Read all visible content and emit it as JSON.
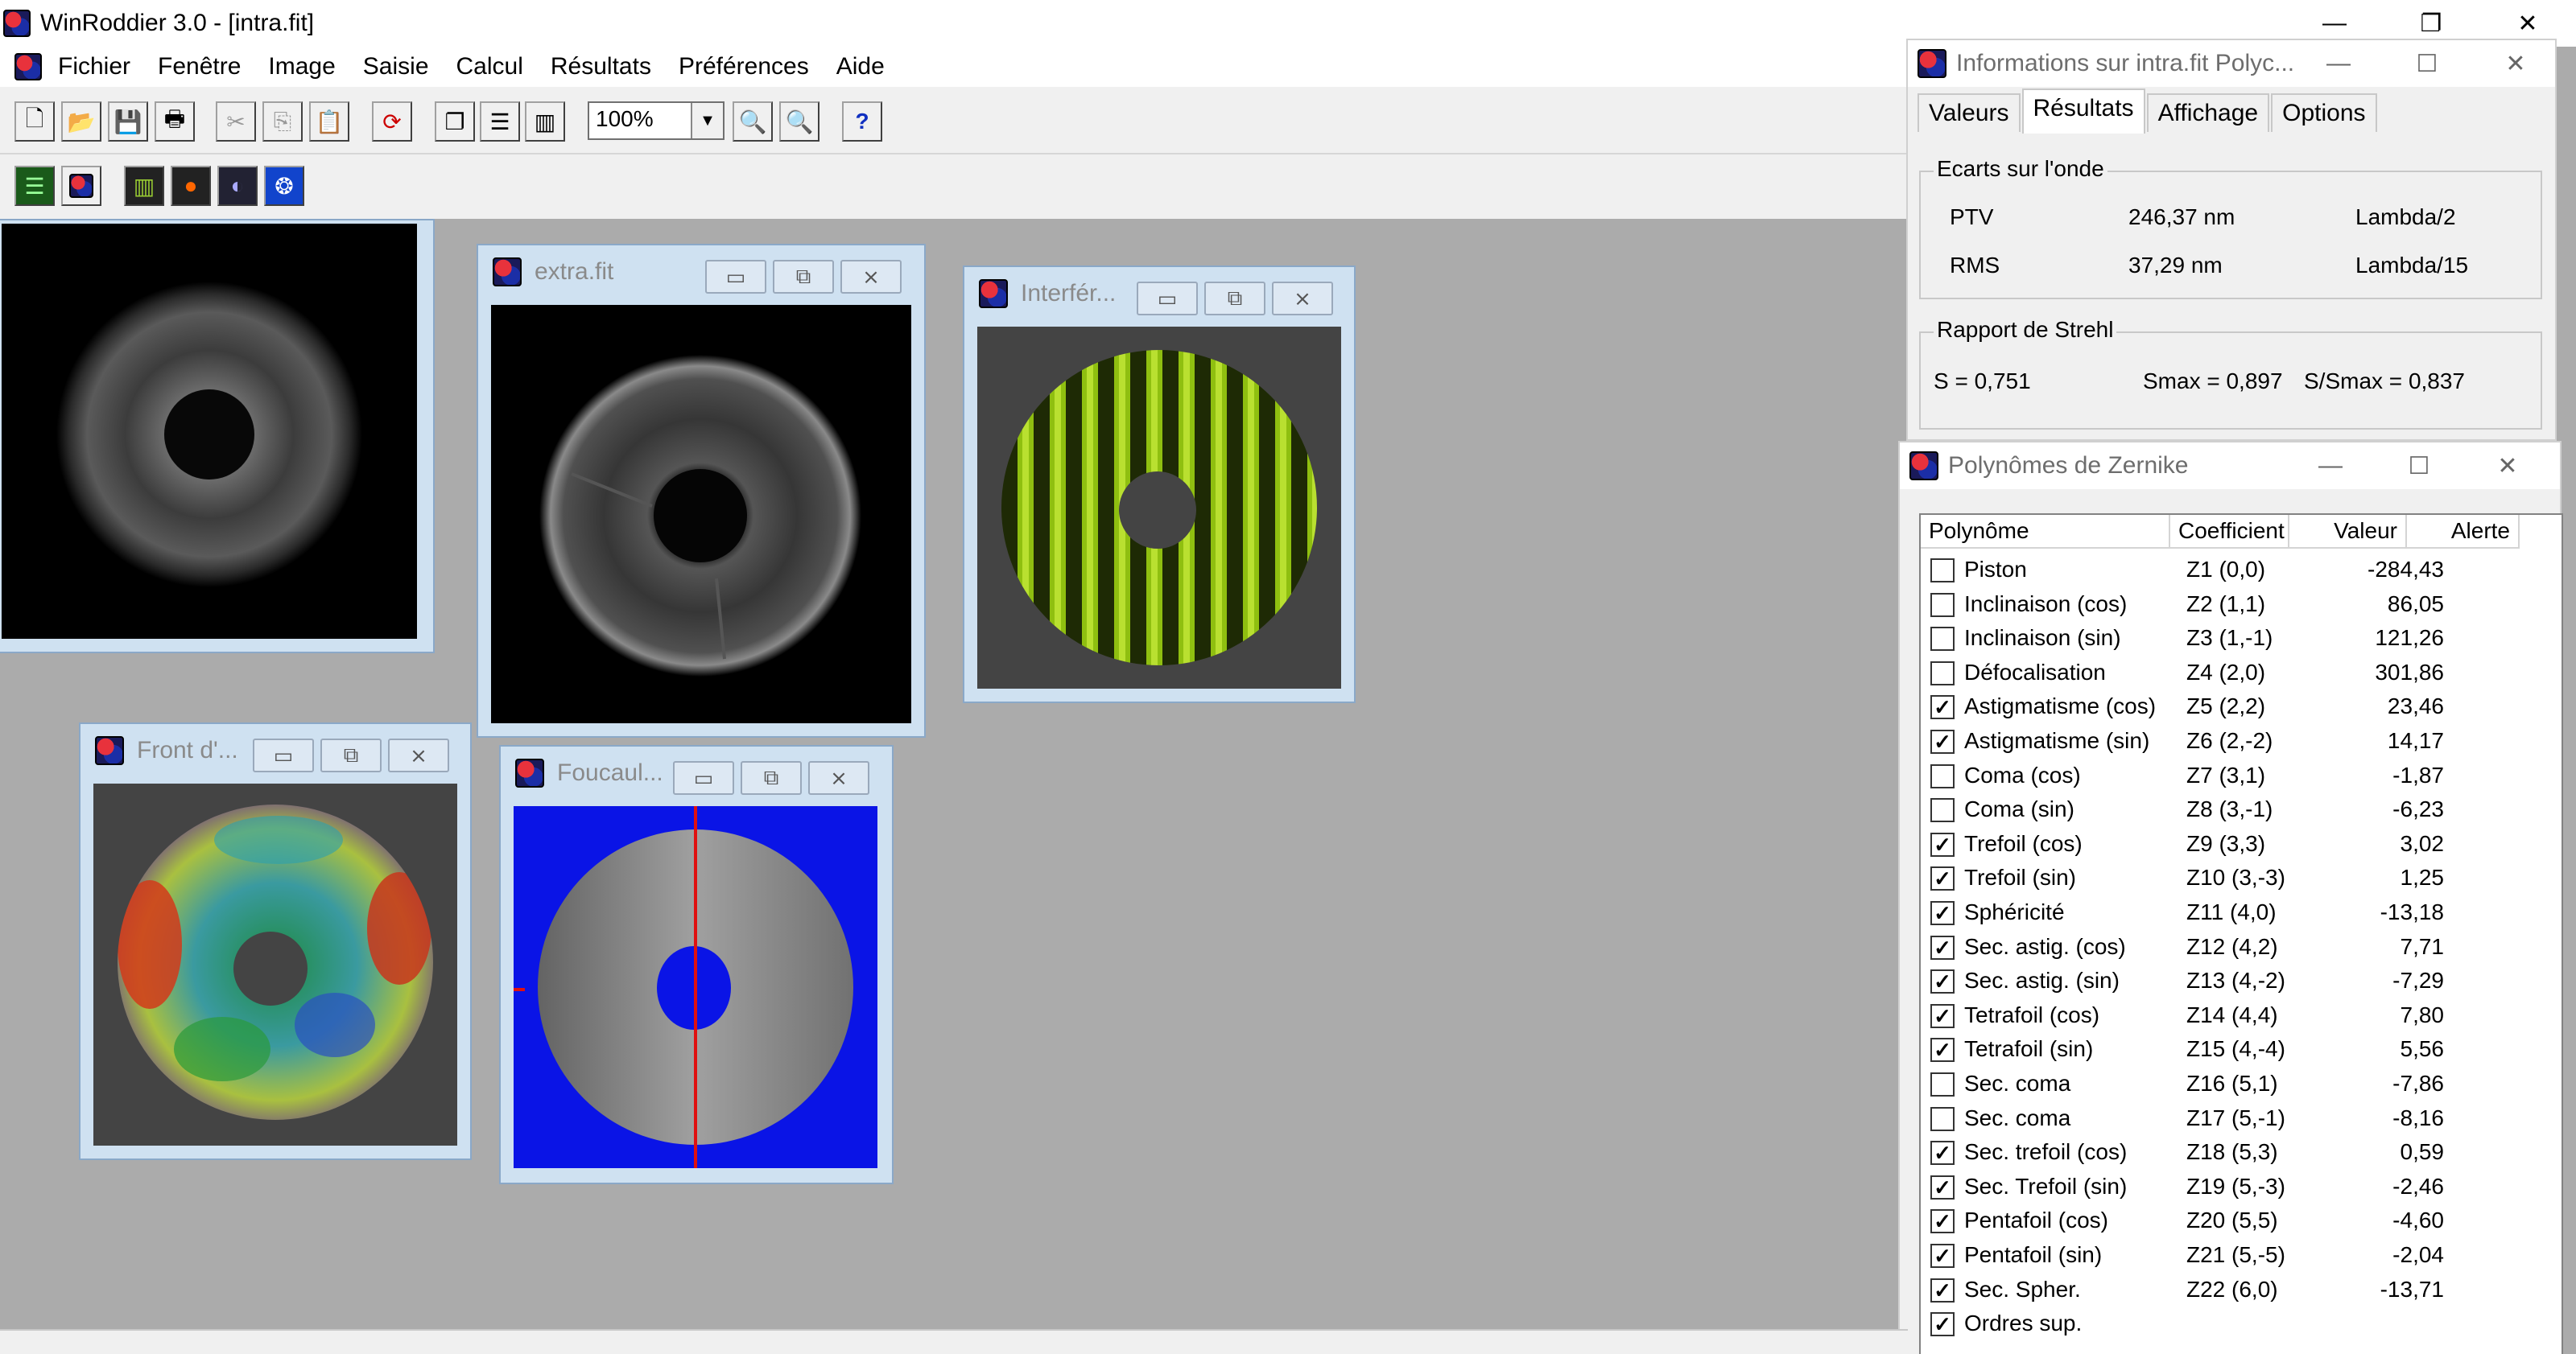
{
  "app": {
    "title": "WinRoddier 3.0 - [intra.fit]",
    "caption_minimize": "—",
    "caption_restore": "❐",
    "caption_close": "✕"
  },
  "menu": [
    "Fichier",
    "Fenêtre",
    "Image",
    "Saisie",
    "Calcul",
    "Résultats",
    "Préférences",
    "Aide"
  ],
  "toolbar": {
    "zoom_value": "100%",
    "help_label": "?"
  },
  "windows": {
    "extra_title": "extra.fit",
    "interf_title": "Interfér...",
    "front_title": "Front d'...",
    "foucault_title": "Foucaul..."
  },
  "info_panel": {
    "title": "Informations sur intra.fit Polyc...",
    "tabs": [
      "Valeurs",
      "Résultats",
      "Affichage",
      "Options"
    ],
    "active_tab": "Résultats",
    "ecarts_label": "Ecarts sur l'onde",
    "ptv_label": "PTV",
    "ptv_value": "246,37 nm",
    "ptv_lambda": "Lambda/2",
    "rms_label": "RMS",
    "rms_value": "37,29 nm",
    "rms_lambda": "Lambda/15",
    "strehl_label": "Rapport de Strehl",
    "s_value": "S = 0,751",
    "smax_value": "Smax = 0,897",
    "ratio_value": "S/Smax = 0,837"
  },
  "zernike_panel": {
    "title": "Polynômes de Zernike",
    "columns": [
      "Polynôme",
      "Coefficient",
      "Valeur",
      "Alerte"
    ],
    "rows": [
      {
        "checked": false,
        "name": "Piston",
        "coef": "Z1 (0,0)",
        "value": "-284,43"
      },
      {
        "checked": false,
        "name": "Inclinaison (cos)",
        "coef": "Z2 (1,1)",
        "value": "86,05"
      },
      {
        "checked": false,
        "name": "Inclinaison (sin)",
        "coef": "Z3 (1,-1)",
        "value": "121,26"
      },
      {
        "checked": false,
        "name": "Défocalisation",
        "coef": "Z4 (2,0)",
        "value": "301,86"
      },
      {
        "checked": true,
        "name": "Astigmatisme (cos)",
        "coef": "Z5 (2,2)",
        "value": "23,46"
      },
      {
        "checked": true,
        "name": "Astigmatisme (sin)",
        "coef": "Z6 (2,-2)",
        "value": "14,17"
      },
      {
        "checked": false,
        "name": "Coma (cos)",
        "coef": "Z7 (3,1)",
        "value": "-1,87"
      },
      {
        "checked": false,
        "name": "Coma (sin)",
        "coef": "Z8 (3,-1)",
        "value": "-6,23"
      },
      {
        "checked": true,
        "name": "Trefoil (cos)",
        "coef": "Z9 (3,3)",
        "value": "3,02"
      },
      {
        "checked": true,
        "name": "Trefoil (sin)",
        "coef": "Z10 (3,-3)",
        "value": "1,25"
      },
      {
        "checked": true,
        "name": "Sphéricité",
        "coef": "Z11 (4,0)",
        "value": "-13,18"
      },
      {
        "checked": true,
        "name": "Sec. astig. (cos)",
        "coef": "Z12 (4,2)",
        "value": "7,71"
      },
      {
        "checked": true,
        "name": "Sec. astig. (sin)",
        "coef": "Z13 (4,-2)",
        "value": "-7,29"
      },
      {
        "checked": true,
        "name": "Tetrafoil (cos)",
        "coef": "Z14 (4,4)",
        "value": "7,80"
      },
      {
        "checked": true,
        "name": "Tetrafoil (sin)",
        "coef": "Z15 (4,-4)",
        "value": "5,56"
      },
      {
        "checked": false,
        "name": "Sec. coma",
        "coef": "Z16 (5,1)",
        "value": "-7,86"
      },
      {
        "checked": false,
        "name": "Sec. coma",
        "coef": "Z17 (5,-1)",
        "value": "-8,16"
      },
      {
        "checked": true,
        "name": "Sec. trefoil (cos)",
        "coef": "Z18 (5,3)",
        "value": "0,59"
      },
      {
        "checked": true,
        "name": "Sec. Trefoil (sin)",
        "coef": "Z19 (5,-3)",
        "value": "-2,46"
      },
      {
        "checked": true,
        "name": "Pentafoil (cos)",
        "coef": "Z20 (5,5)",
        "value": "-4,60"
      },
      {
        "checked": true,
        "name": "Pentafoil (sin)",
        "coef": "Z21 (5,-5)",
        "value": "-2,04"
      },
      {
        "checked": true,
        "name": "Sec. Spher.",
        "coef": "Z22 (6,0)",
        "value": "-13,71"
      },
      {
        "checked": true,
        "name": "Ordres sup.",
        "coef": "",
        "value": ""
      }
    ]
  }
}
